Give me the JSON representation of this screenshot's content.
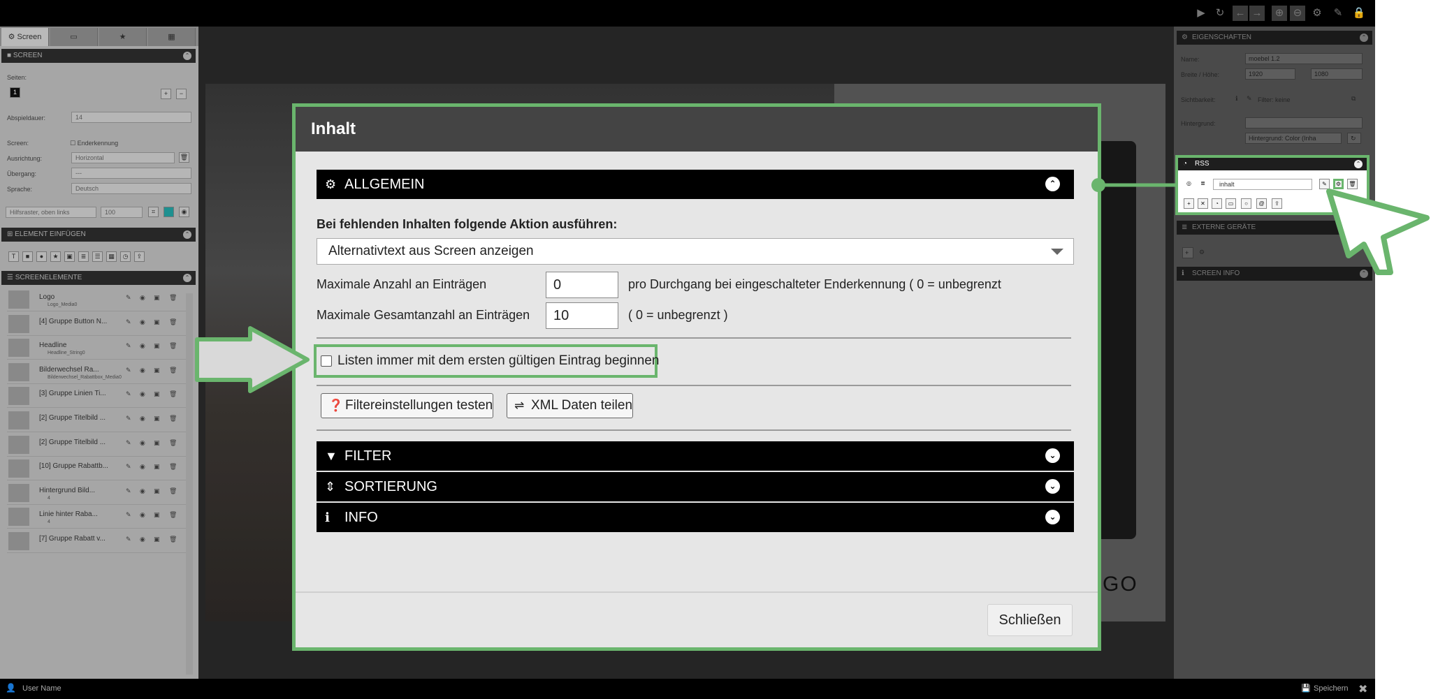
{
  "left_panel": {
    "tabs": [
      "Screen",
      "",
      "",
      ""
    ],
    "screen_section": {
      "header": "SCREEN",
      "pages_label": "Seiten:",
      "page_number": "1",
      "duration_label": "Abspieldauer:",
      "duration_value": "14",
      "screen_label": "Screen:",
      "end_detection_label": "Enderkennung",
      "orientation_label": "Ausrichtung:",
      "orientation_value": "Horizontal",
      "transition_label": "Übergang:",
      "transition_value": "---",
      "language_label": "Sprache:",
      "language_value": "Deutsch",
      "grid_label": "Hilfsraster, oben links",
      "grid_value": "100"
    },
    "insert_section": {
      "header": "ELEMENT EINFÜGEN"
    },
    "elements_section": {
      "header": "SCREENELEMENTE",
      "items": [
        {
          "name": "Logo",
          "sub": "Logo_Media0",
          "prefix": ""
        },
        {
          "name": "Gruppe Button N...",
          "sub": "",
          "prefix": "[4]"
        },
        {
          "name": "Headline",
          "sub": "Headline_String0",
          "prefix": ""
        },
        {
          "name": "Bilderwechsel Ra...",
          "sub": "Bilderwechsel_Rabattbox_Media0",
          "prefix": ""
        },
        {
          "name": "Gruppe Linien Ti...",
          "sub": "",
          "prefix": "[3]"
        },
        {
          "name": "Gruppe Titelbild ...",
          "sub": "",
          "prefix": "[2]"
        },
        {
          "name": "Gruppe Titelbild ...",
          "sub": "",
          "prefix": "[2]"
        },
        {
          "name": "Gruppe Rabattb...",
          "sub": "",
          "prefix": "[10]"
        },
        {
          "name": "Hintergrund Bild...",
          "sub": "4",
          "prefix": ""
        },
        {
          "name": "Linie hinter Raba...",
          "sub": "4",
          "prefix": ""
        },
        {
          "name": "Gruppe Rabatt v...",
          "sub": "",
          "prefix": "[7]"
        }
      ]
    }
  },
  "right_panel": {
    "properties_header": "EIGENSCHAFTEN",
    "name_label": "Name:",
    "name_value": "moebel 1.2",
    "size_label": "Breite / Höhe:",
    "width_value": "1920",
    "height_value": "1080",
    "visibility_label": "Sichtbarkeit:",
    "filter_label": "Filter: keine",
    "background_label": "Hintergrund:",
    "background_select": "Hintergrund: Color (Inha",
    "rss_header": "RSS",
    "rss_input": "inhalt",
    "external_header": "EXTERNE GERÄTE",
    "screeninfo_header": "SCREEN INFO"
  },
  "canvas": {
    "logo_text": "GO"
  },
  "bottom_bar": {
    "user": "User Name",
    "save": "Speichern"
  },
  "modal": {
    "title": "Inhalt",
    "section_general": "ALLGEMEIN",
    "missing_action_label": "Bei fehlenden Inhalten folgende Aktion ausführen:",
    "missing_action_value": "Alternativtext aus Screen anzeigen",
    "max_entries_label": "Maximale Anzahl an Einträgen",
    "max_entries_value": "0",
    "max_entries_hint": "pro Durchgang bei eingeschalteter Enderkennung ( 0 = unbegrenzt",
    "max_total_label": "Maximale Gesamtanzahl an Einträgen",
    "max_total_value": "10",
    "max_total_hint": "( 0 = unbegrenzt )",
    "start_first_label": "Listen immer mit dem ersten gültigen Eintrag beginnen",
    "test_filter_button": "Filtereinstellungen testen",
    "share_xml_button": "XML Daten teilen",
    "section_filter": "FILTER",
    "section_sort": "SORTIERUNG",
    "section_info": "INFO",
    "close_button": "Schließen"
  },
  "colors": {
    "highlight": "#6ab56d",
    "modal_header": "#444444",
    "accordion": "#000000"
  }
}
